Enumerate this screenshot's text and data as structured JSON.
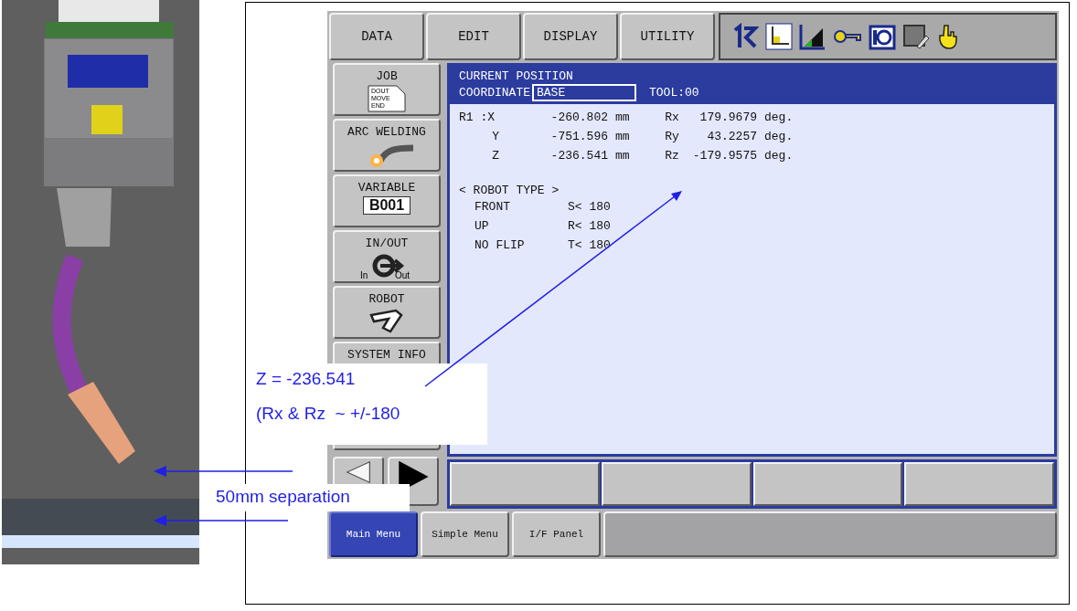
{
  "pendant": {
    "menu_tabs": [
      {
        "label": "DATA"
      },
      {
        "label": "EDIT"
      },
      {
        "label": "DISPLAY"
      },
      {
        "label": "UTILITY"
      }
    ],
    "main_menu": [
      {
        "label": "JOB",
        "kind": "job",
        "icon_lines": [
          "DOUT",
          "MOVE",
          "END"
        ]
      },
      {
        "label": "ARC WELDING",
        "kind": "arc"
      },
      {
        "label": "VARIABLE",
        "kind": "variable",
        "value": "B001"
      },
      {
        "label": "IN/OUT",
        "kind": "inout",
        "icon_lines": [
          "In",
          "Out"
        ]
      },
      {
        "label": "ROBOT",
        "kind": "robot"
      },
      {
        "label": "SYSTEM INFO",
        "kind": "plain"
      }
    ],
    "page_arrows": [
      {
        "kind": "left",
        "disabled": true
      },
      {
        "kind": "right",
        "disabled": false
      }
    ],
    "position": {
      "title": "CURRENT POSITION",
      "coordinate_label": "COORDINATE",
      "coordinate": "BASE",
      "tool": "TOOL:00",
      "rows": [
        {
          "axis": "R1 :X",
          "value": "-260.802",
          "unit": "mm",
          "rot_axis": "Rx",
          "rot_value": "179.9679",
          "rot_unit": "deg."
        },
        {
          "axis": "Y",
          "value": "-751.596",
          "unit": "mm",
          "rot_axis": "Ry",
          "rot_value": "43.2257",
          "rot_unit": "deg."
        },
        {
          "axis": "Z",
          "value": "-236.541",
          "unit": "mm",
          "rot_axis": "Rz",
          "rot_value": "-179.9575",
          "rot_unit": "deg."
        }
      ],
      "robot_type_title": "< ROBOT TYPE >",
      "robot_type": [
        {
          "label": "FRONT",
          "limit": "S< 180"
        },
        {
          "label": "UP",
          "limit": "R< 180"
        },
        {
          "label": "NO FLIP",
          "limit": "T< 180"
        }
      ]
    },
    "bottom_tabs": [
      {
        "label": "Main Menu",
        "selected": true
      },
      {
        "label": "Simple Menu",
        "selected": false
      },
      {
        "label": "I/F Panel",
        "selected": false
      }
    ]
  },
  "annotations": {
    "note_lines": [
      "Z = -236.541",
      "(Rx & Rz  ~ +/-180"
    ],
    "separation": "50mm separation"
  }
}
